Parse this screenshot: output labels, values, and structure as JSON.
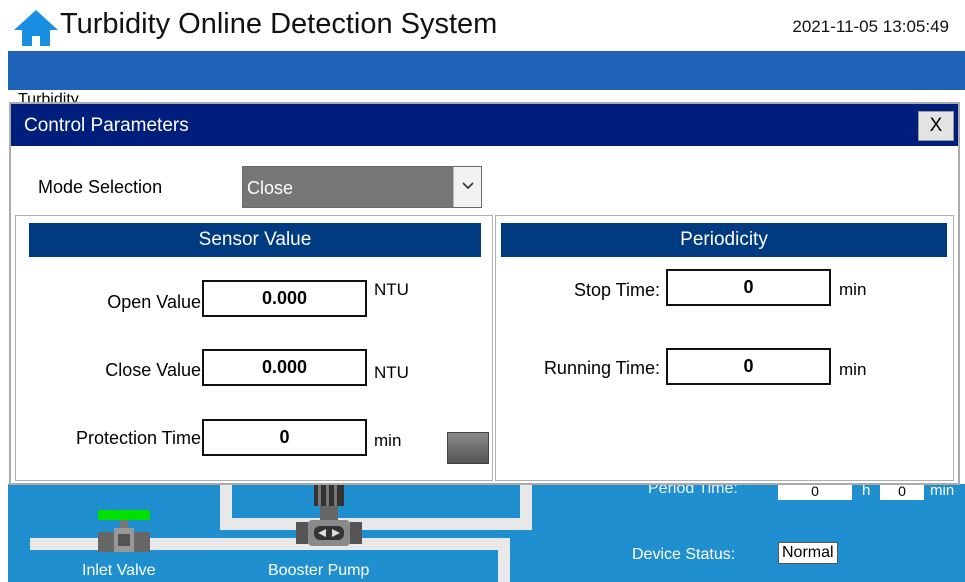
{
  "app": {
    "title": "Turbidity Online Detection System",
    "datetime": "2021-11-05 13:05:49",
    "tab_label": "Turbidity",
    "home_icon": "home-icon"
  },
  "dialog": {
    "title": "Control Parameters",
    "close_label": "X",
    "mode": {
      "label": "Mode Selection",
      "value": "Close"
    },
    "sensor": {
      "header": "Sensor Value",
      "open_label": "Open Value:",
      "open_value": "0.000",
      "open_unit": "NTU",
      "close_label": "Close Value:",
      "close_value": "0.000",
      "close_unit": "NTU",
      "protection_label": "Protection Time:",
      "protection_value": "0",
      "protection_unit": "min"
    },
    "periodicity": {
      "header": "Periodicity",
      "stop_label": "Stop Time:",
      "stop_value": "0",
      "stop_unit": "min",
      "running_label": "Running Time:",
      "running_value": "0",
      "running_unit": "min"
    }
  },
  "process": {
    "inlet_valve_label": "Inlet Valve",
    "booster_pump_label": "Booster Pump",
    "period_time_label": "Period Time:",
    "period_hours": "0",
    "period_hours_unit": "h",
    "period_minutes": "0",
    "period_minutes_unit": "min",
    "device_status_label": "Device Status:",
    "device_status_value": "Normal"
  },
  "colors": {
    "nav_bar": "#1e63b8",
    "dialog_titlebar": "#001f7d",
    "panel_header": "#003a80",
    "process_background": "#1f8fd0",
    "valve_indicator": "#00e000"
  }
}
